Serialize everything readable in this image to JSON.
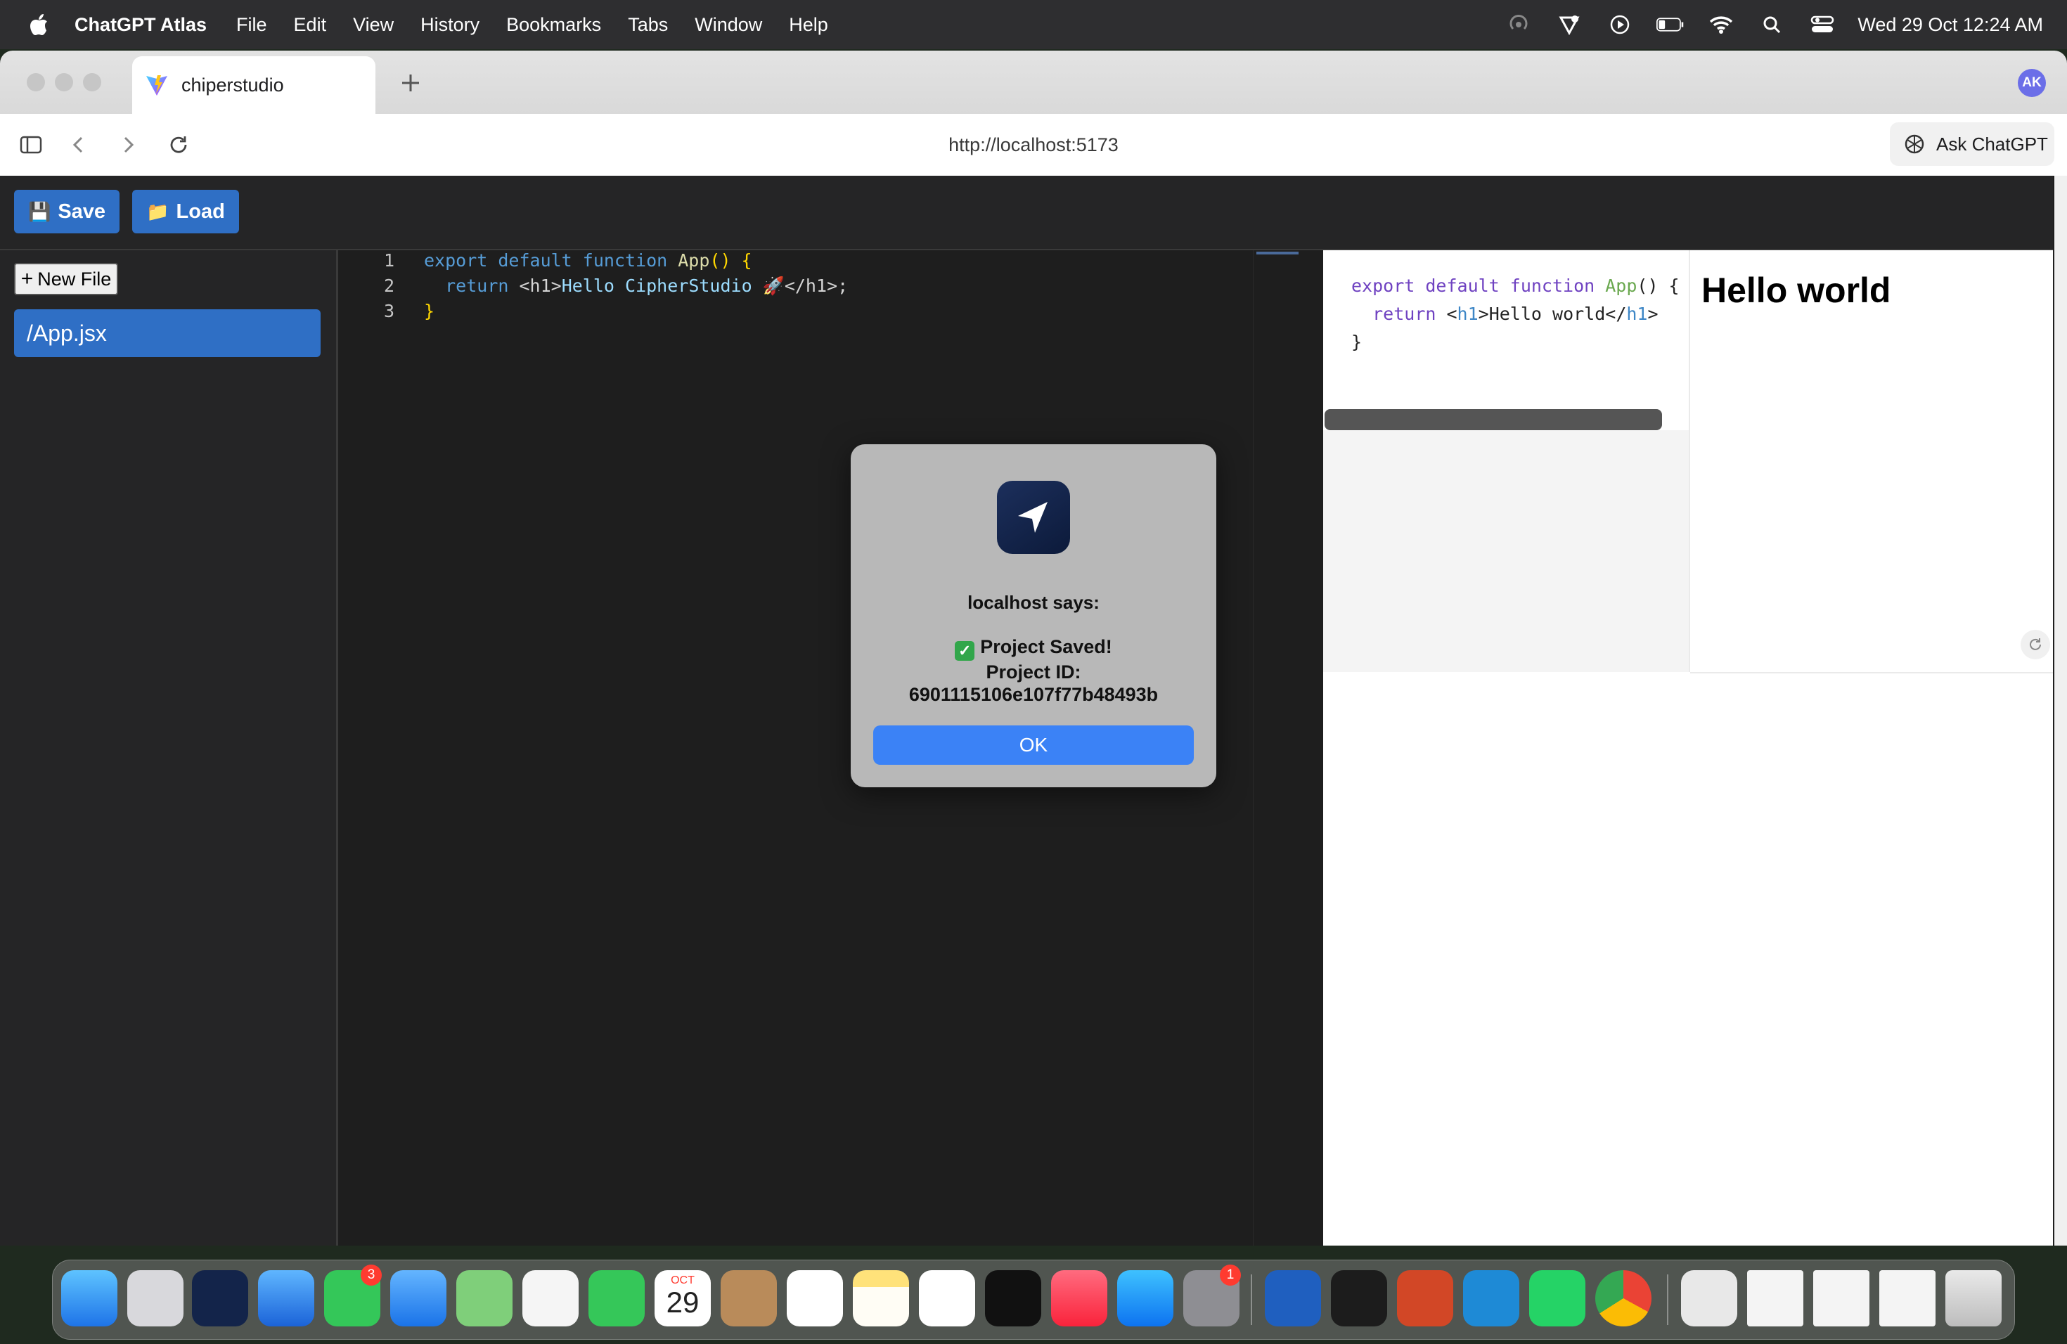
{
  "menubar": {
    "app_name": "ChatGPT Atlas",
    "items": [
      "File",
      "Edit",
      "View",
      "History",
      "Bookmarks",
      "Tabs",
      "Window",
      "Help"
    ],
    "clock": "Wed 29 Oct  12:24 AM"
  },
  "browser": {
    "tab_title": "chiperstudio",
    "url": "http://localhost:5173",
    "ask_label": "Ask ChatGPT",
    "profile_initials": "AK"
  },
  "app": {
    "save_label": "Save",
    "load_label": "Load",
    "new_file_label": "New File",
    "files": [
      "/App.jsx"
    ]
  },
  "editor": {
    "line_numbers": [
      "1",
      "2",
      "3"
    ],
    "lines": {
      "l1_kw": "export default function",
      "l1_fn": "App",
      "l1_rest": "() {",
      "l2_kw": "return",
      "l2_open": "<h1>",
      "l2_text": "Hello CipherStudio 🚀",
      "l2_close": "</h1>;",
      "l3": "}"
    }
  },
  "preview": {
    "code": {
      "l1_kw": "export default function",
      "l1_fn": "App",
      "l1_rest": "() {",
      "l2_kw": "return",
      "l2_open": "<",
      "l2_tag": "h1",
      "l2_text": ">Hello world</",
      "l2_tag_close": "h1",
      "l2_end": ">",
      "l3": "}"
    },
    "heading": "Hello world"
  },
  "dialog": {
    "title": "localhost says:",
    "line1": "Project Saved!",
    "line2": "Project ID:",
    "line3": "6901115106e107f77b48493b",
    "ok_label": "OK"
  },
  "dock": {
    "apps": [
      "finder",
      "launchpad",
      "chatgpt-atlas",
      "safari",
      "messages",
      "mail",
      "maps",
      "photos",
      "facetime",
      "calendar",
      "contacts",
      "reminders",
      "notes",
      "freeform",
      "apple-tv",
      "music",
      "app-store",
      "system-settings",
      "word",
      "terminal",
      "powerpoint",
      "vscode",
      "whatsapp",
      "chrome",
      "preview",
      "window-1",
      "window-2",
      "window-3",
      "trash"
    ],
    "messages_badge": "3",
    "settings_badge": "1",
    "calendar_month": "OCT",
    "calendar_day": "29"
  },
  "colors": {
    "accent_blue": "#2f6fc5",
    "dialog_button": "#3b82f6",
    "editor_bg": "#1e1e1e"
  }
}
